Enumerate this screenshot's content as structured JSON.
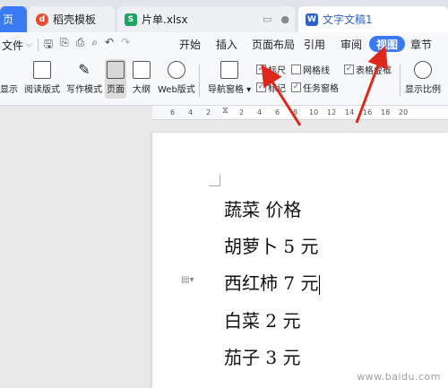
{
  "tabs": {
    "home": "页",
    "template": "稻壳模板",
    "sheet": "片单.xlsx",
    "doc": "文字文稿1"
  },
  "toolbar": {
    "file": "文件",
    "menus": [
      "开始",
      "插入",
      "页面布局",
      "引用",
      "审阅",
      "视图",
      "章节"
    ],
    "active_menu": "视图"
  },
  "ribbon": {
    "buttons": [
      "显示",
      "阅读版式",
      "写作模式",
      "页面",
      "大纲",
      "Web版式",
      "导航窗格",
      "显示比例"
    ],
    "checkboxes": [
      {
        "label": "标尺",
        "checked": true
      },
      {
        "label": "网格线",
        "checked": false
      },
      {
        "label": "表格虚框",
        "checked": true
      },
      {
        "label": "标记",
        "checked": true
      },
      {
        "label": "任务窗格",
        "checked": true
      }
    ]
  },
  "ruler": {
    "ticks": [
      "6",
      "4",
      "2",
      "2",
      "4",
      "6",
      "8",
      "10",
      "12",
      "14",
      "16",
      "18",
      "20"
    ]
  },
  "document": {
    "lines": [
      "蔬菜 价格",
      "胡萝卜 5 元",
      "西红柿 7 元",
      "白菜 2 元",
      "茄子 3 元"
    ]
  },
  "watermark": "www.baidu.com",
  "colors": {
    "accent": "#3a7bf5",
    "arrow": "#e0271e"
  }
}
